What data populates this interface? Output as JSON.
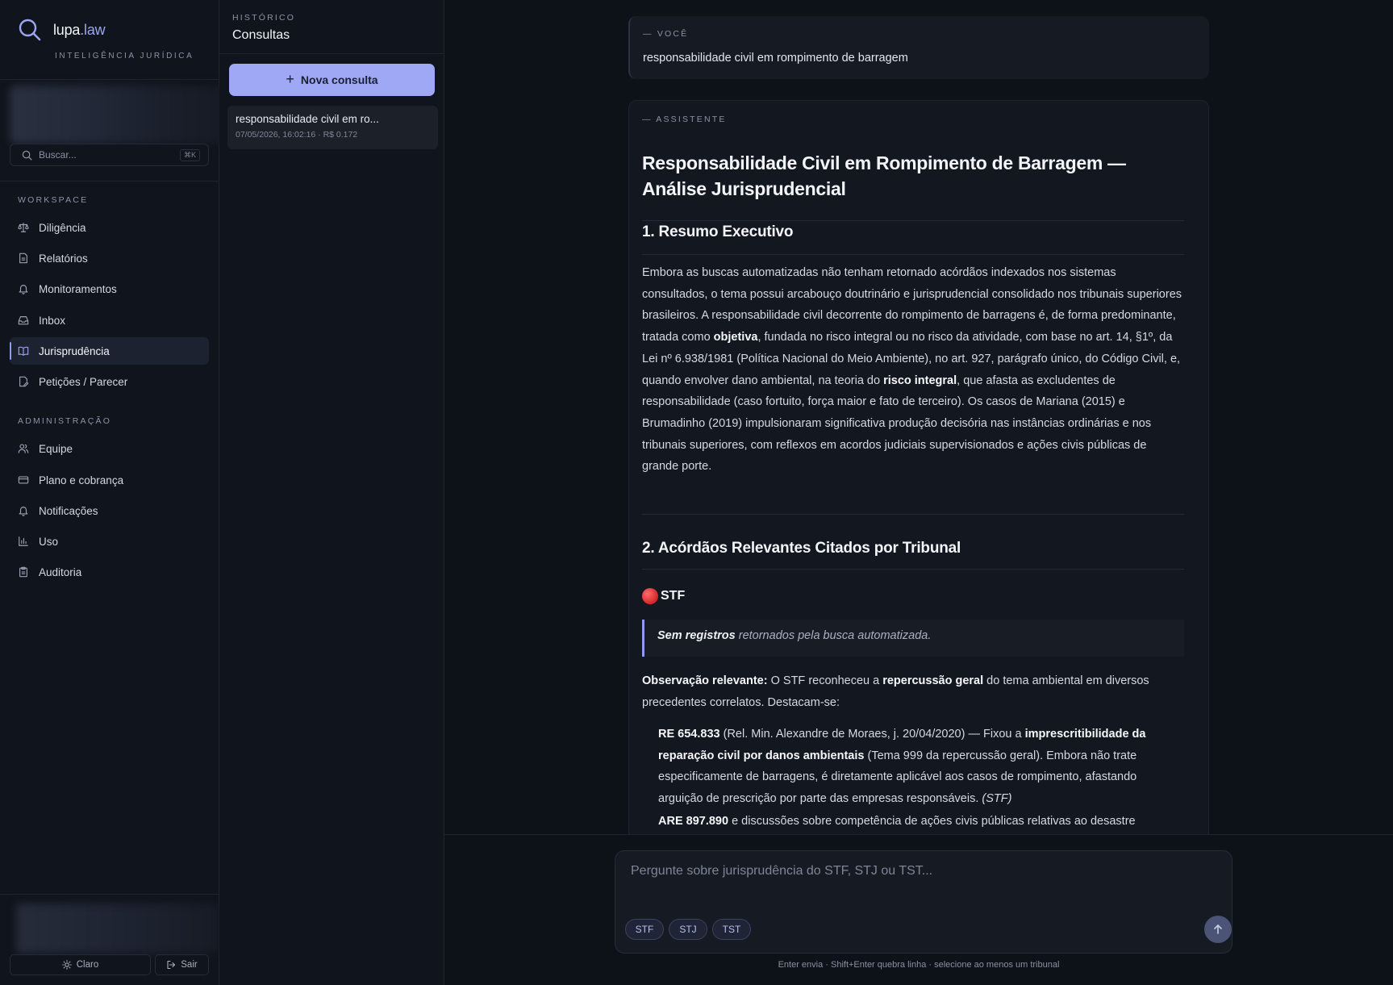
{
  "brand": {
    "name": "lupa",
    "domain": ".law",
    "tagline": "INTELIGÊNCIA JURÍDICA"
  },
  "search": {
    "placeholder": "Buscar...",
    "shortcut": "⌘K"
  },
  "sidebar": {
    "workspace_label": "WORKSPACE",
    "workspace": [
      {
        "label": "Diligência",
        "icon": "scale-icon"
      },
      {
        "label": "Relatórios",
        "icon": "document-icon"
      },
      {
        "label": "Monitoramentos",
        "icon": "bell-icon"
      },
      {
        "label": "Inbox",
        "icon": "inbox-icon"
      },
      {
        "label": "Jurisprudência",
        "icon": "book-icon",
        "active": true
      },
      {
        "label": "Petições / Parecer",
        "icon": "file-edit-icon"
      }
    ],
    "admin_label": "ADMINISTRAÇÃO",
    "admin": [
      {
        "label": "Equipe",
        "icon": "users-icon"
      },
      {
        "label": "Plano e cobrança",
        "icon": "credit-card-icon"
      },
      {
        "label": "Notificações",
        "icon": "bell-icon"
      },
      {
        "label": "Uso",
        "icon": "bar-chart-icon"
      },
      {
        "label": "Auditoria",
        "icon": "clipboard-icon"
      }
    ],
    "theme_label": "Claro",
    "logout_label": "Sair"
  },
  "history": {
    "kicker": "HISTÓRICO",
    "title": "Consultas",
    "new_label": "Nova consulta",
    "items": [
      {
        "title": "responsabilidade civil em ro...",
        "meta": "07/05/2026, 16:02:16 · R$ 0.172"
      }
    ]
  },
  "chat": {
    "user_role": "— VOCÊ",
    "user_query": "responsabilidade civil em rompimento de barragem",
    "assistant_role": "— ASSISTENTE",
    "title": "Responsabilidade Civil em Rompimento de Barragem — Análise Jurisprudencial",
    "section1": "1. Resumo Executivo",
    "section1_parts": [
      "Embora as buscas automatizadas não tenham retornado acórdãos indexados nos sistemas consultados, o tema possui arcabouço doutrinário e jurisprudencial consolidado nos tribunais superiores brasileiros. A responsabilidade civil decorrente do rompimento de barragens é, de forma predominante, tratada como ",
      "objetiva",
      ", fundada no risco integral ou no risco da atividade, com base no art. 14, §1º, da Lei nº 6.938/1981 (Política Nacional do Meio Ambiente), no art. 927, parágrafo único, do Código Civil, e, quando envolver dano ambiental, na teoria do ",
      "risco integral",
      ", que afasta as excludentes de responsabilidade (caso fortuito, força maior e fato de terceiro). Os casos de Mariana (2015) e Brumadinho (2019) impulsionaram significativa produção decisória nas instâncias ordinárias e nos tribunais superiores, com reflexos em acordos judiciais supervisionados e ações civis públicas de grande porte."
    ],
    "section2": "2. Acórdãos Relevantes Citados por Tribunal",
    "stf_label": "STF",
    "quote_bold": "Sem registros",
    "quote_rest": " retornados pela busca automatizada.",
    "obs_parts": [
      "Observação relevante:",
      " O STF reconheceu a ",
      "repercussão geral",
      " do tema ambiental em diversos precedentes correlatos. Destacam-se:"
    ],
    "re_parts": [
      "RE 654.833",
      " (Rel. Min. Alexandre de Moraes, j. 20/04/2020) — Fixou a ",
      "imprescritibilidade da reparação civil por danos ambientais",
      " (Tema 999 da repercussão geral). Embora não trate especificamente de barragens, é diretamente aplicável aos casos de rompimento, afastando arguição de prescrição por parte das empresas responsáveis. ",
      "(STF)"
    ],
    "are_parts": [
      "ARE 897.890",
      " e discussões sobre competência de ações civis públicas relativas ao desastre"
    ]
  },
  "composer": {
    "placeholder": "Pergunte sobre jurisprudência do STF, STJ ou TST...",
    "chips": [
      "STF",
      "STJ",
      "TST"
    ],
    "hint": "Enter envia · Shift+Enter quebra linha · selecione ao menos um tribunal"
  }
}
